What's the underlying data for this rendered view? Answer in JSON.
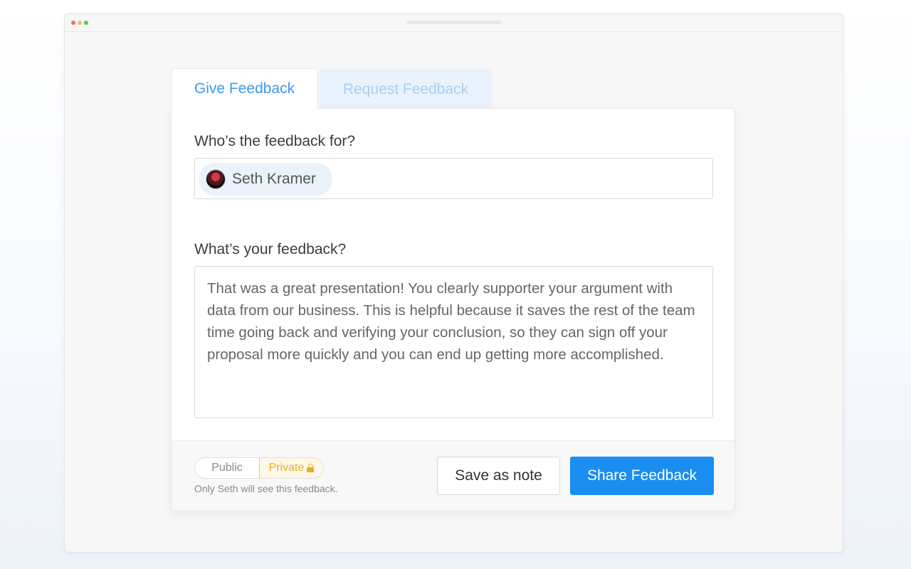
{
  "tabs": {
    "give": "Give Feedback",
    "request": "Request Feedback"
  },
  "form": {
    "recipient_label": "Who’s the feedback for?",
    "recipient_name": "Seth Kramer",
    "feedback_label": "What’s your feedback?",
    "feedback_text": "That was a great presentation! You clearly supporter your argument with data from our business. This is helpful because it saves the rest of the team time going back and verifying your conclusion, so they can sign off your proposal more quickly and you can end up getting more accomplished."
  },
  "footer": {
    "visibility_public": "Public",
    "visibility_private": "Private",
    "visibility_selected": "Private",
    "visibility_hint": "Only Seth will see this feedback.",
    "save_label": "Save as note",
    "share_label": "Share Feedback"
  },
  "colors": {
    "accent": "#1a8ef0",
    "tab_active_text": "#3d99ee",
    "tab_inactive_bg": "#eaf3fd",
    "private_accent": "#eeac22"
  }
}
